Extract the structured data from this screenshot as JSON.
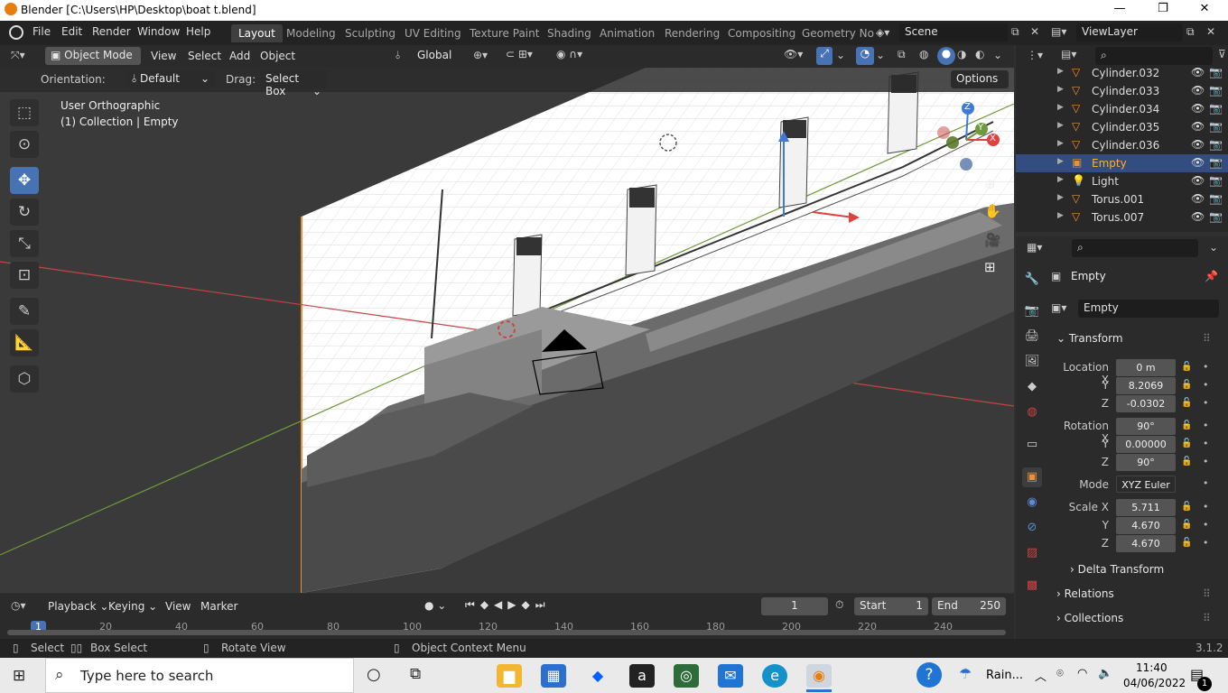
{
  "window": {
    "title": "Blender [C:\\Users\\HP\\Desktop\\boat t.blend]",
    "minimize": "—",
    "maximize": "❐",
    "close": "✕"
  },
  "menubar": {
    "items": [
      "File",
      "Edit",
      "Render",
      "Window",
      "Help"
    ]
  },
  "workspaces": {
    "tabs": [
      "Layout",
      "Modeling",
      "Sculpting",
      "UV Editing",
      "Texture Paint",
      "Shading",
      "Animation",
      "Rendering",
      "Compositing",
      "Geometry No"
    ],
    "active": "Layout"
  },
  "scene": {
    "label": "Scene"
  },
  "viewlayer": {
    "label": "ViewLayer"
  },
  "viewport_header": {
    "mode": "Object Mode",
    "menus": [
      "View",
      "Select",
      "Add",
      "Object"
    ],
    "transform_orientation": "Global"
  },
  "tool_settings": {
    "orientation_label": "Orientation:",
    "orientation_value": "Default",
    "drag_label": "Drag:",
    "drag_value": "Select Box",
    "options": "Options"
  },
  "viewport": {
    "view_name": "User Orthographic",
    "collection_info": "(1) Collection | Empty"
  },
  "gizmo": {
    "z": "Z",
    "y": "Y",
    "x": "X"
  },
  "outliner": {
    "items": [
      {
        "name": "Cylinder.032",
        "icon": "mesh-icon",
        "selected": false
      },
      {
        "name": "Cylinder.033",
        "icon": "mesh-icon",
        "selected": false
      },
      {
        "name": "Cylinder.034",
        "icon": "mesh-icon",
        "selected": false
      },
      {
        "name": "Cylinder.035",
        "icon": "mesh-icon",
        "selected": false
      },
      {
        "name": "Cylinder.036",
        "icon": "mesh-icon",
        "selected": false
      },
      {
        "name": "Empty",
        "icon": "empty-image-icon",
        "selected": true
      },
      {
        "name": "Light",
        "icon": "light-icon",
        "selected": false
      },
      {
        "name": "Torus.001",
        "icon": "mesh-icon",
        "selected": false
      },
      {
        "name": "Torus.007",
        "icon": "mesh-icon",
        "selected": false
      }
    ]
  },
  "properties": {
    "object_name": "Empty",
    "object_field": "Empty",
    "transform_title": "Transform",
    "location": {
      "label": "Location X",
      "x": "0 m",
      "y": "8.2069",
      "z": "-0.0302"
    },
    "rotation": {
      "label": "Rotation X",
      "x": "90°",
      "y": "0.00000",
      "z": "90°"
    },
    "mode": {
      "label": "Mode",
      "value": "XYZ Euler"
    },
    "scale": {
      "label": "Scale X",
      "x": "5.711",
      "y": "4.670",
      "z": "4.670"
    },
    "axis_y": "Y",
    "axis_z": "Z",
    "delta": "Delta Transform",
    "relations": "Relations",
    "collections": "Collections"
  },
  "timeline": {
    "menus": [
      "Playback",
      "Keying",
      "View",
      "Marker"
    ],
    "current_frame": "1",
    "start_label": "Start",
    "start_value": "1",
    "end_label": "End",
    "end_value": "250",
    "ruler": [
      "1",
      "20",
      "40",
      "60",
      "80",
      "100",
      "120",
      "140",
      "160",
      "180",
      "200",
      "220",
      "240"
    ]
  },
  "statusbar": {
    "select": "Select",
    "box_select": "Box Select",
    "rotate_view": "Rotate View",
    "context_menu": "Object Context Menu",
    "version": "3.1.2"
  },
  "taskbar": {
    "search_placeholder": "Type here to search",
    "weather": "Rain...",
    "time": "11:40",
    "date": "04/06/2022",
    "notifications": "1"
  },
  "colors": {
    "accent": "#4772b3",
    "selected_row": "#334d80",
    "object_orange": "#e8913a"
  }
}
